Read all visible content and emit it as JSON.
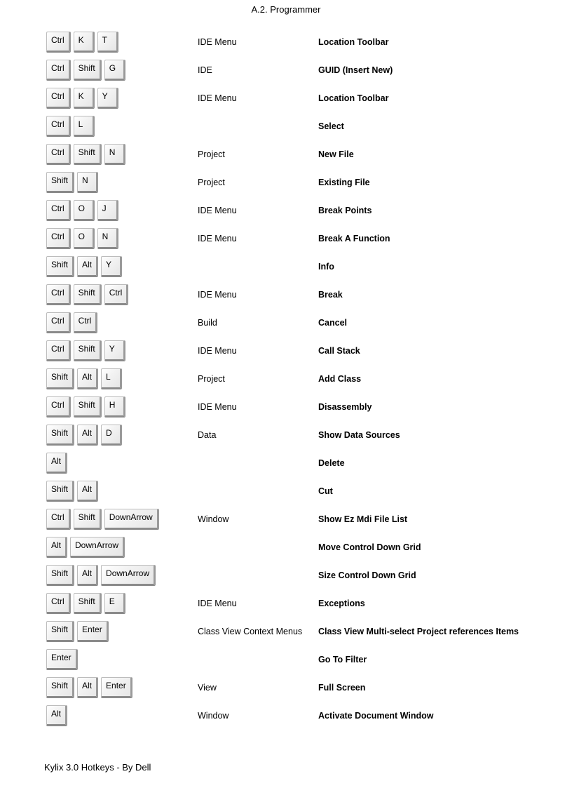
{
  "header": "A.2.   Programmer",
  "footer": "Kylix 3.0 Hotkeys - By Dell",
  "rows": [
    {
      "keys": [
        "Ctrl",
        "K",
        "T"
      ],
      "menu": "IDE Menu",
      "action": "Location Toolbar"
    },
    {
      "keys": [
        "Ctrl",
        "Shift",
        "G"
      ],
      "menu": "IDE",
      "action": "GUID (Insert New)"
    },
    {
      "keys": [
        "Ctrl",
        "K",
        "Y"
      ],
      "menu": "IDE Menu",
      "action": "Location Toolbar"
    },
    {
      "keys": [
        "Ctrl",
        "L"
      ],
      "menu": "",
      "action": "Select"
    },
    {
      "keys": [
        "Ctrl",
        "Shift",
        "N"
      ],
      "menu": "Project",
      "action": "New File"
    },
    {
      "keys": [
        "Shift",
        "N"
      ],
      "menu": "Project",
      "action": "Existing File"
    },
    {
      "keys": [
        "Ctrl",
        "O",
        "J"
      ],
      "menu": "IDE Menu",
      "action": "Break Points"
    },
    {
      "keys": [
        "Ctrl",
        "O",
        "N"
      ],
      "menu": "IDE Menu",
      "action": "Break A Function"
    },
    {
      "keys": [
        "Shift",
        "Alt",
        "Y"
      ],
      "menu": "",
      "action": "Info"
    },
    {
      "keys": [
        "Ctrl",
        "Shift",
        "Ctrl"
      ],
      "menu": "IDE Menu",
      "action": "Break"
    },
    {
      "keys": [
        "Ctrl",
        "Ctrl"
      ],
      "menu": "Build",
      "action": "Cancel"
    },
    {
      "keys": [
        "Ctrl",
        "Shift",
        "Y"
      ],
      "menu": "IDE Menu",
      "action": "Call Stack"
    },
    {
      "keys": [
        "Shift",
        "Alt",
        "L"
      ],
      "menu": "Project",
      "action": "Add Class"
    },
    {
      "keys": [
        "Ctrl",
        "Shift",
        "H"
      ],
      "menu": "IDE Menu",
      "action": "Disassembly"
    },
    {
      "keys": [
        "Shift",
        "Alt",
        "D"
      ],
      "menu": "Data",
      "action": "Show Data Sources"
    },
    {
      "keys": [
        "Alt"
      ],
      "menu": "",
      "action": "Delete"
    },
    {
      "keys": [
        "Shift",
        "Alt"
      ],
      "menu": "",
      "action": "Cut"
    },
    {
      "keys": [
        "Ctrl",
        "Shift",
        "DownArrow"
      ],
      "menu": "Window",
      "action": "Show Ez Mdi File List"
    },
    {
      "keys": [
        "Alt",
        "DownArrow"
      ],
      "menu": "",
      "action": "Move Control Down Grid"
    },
    {
      "keys": [
        "Shift",
        "Alt",
        "DownArrow"
      ],
      "menu": "",
      "action": "Size Control Down Grid"
    },
    {
      "keys": [
        "Ctrl",
        "Shift",
        "E"
      ],
      "menu": "IDE Menu",
      "action": "Exceptions"
    },
    {
      "keys": [
        "Shift",
        "Enter"
      ],
      "menu": "Class View Context Menus",
      "action": "Class View Multi-select Project references Items"
    },
    {
      "keys": [
        "Enter"
      ],
      "menu": "",
      "action": "Go To Filter"
    },
    {
      "keys": [
        "Shift",
        "Alt",
        "Enter"
      ],
      "menu": "View",
      "action": "Full Screen"
    },
    {
      "keys": [
        "Alt"
      ],
      "menu": "Window",
      "action": "Activate Document Window"
    }
  ]
}
